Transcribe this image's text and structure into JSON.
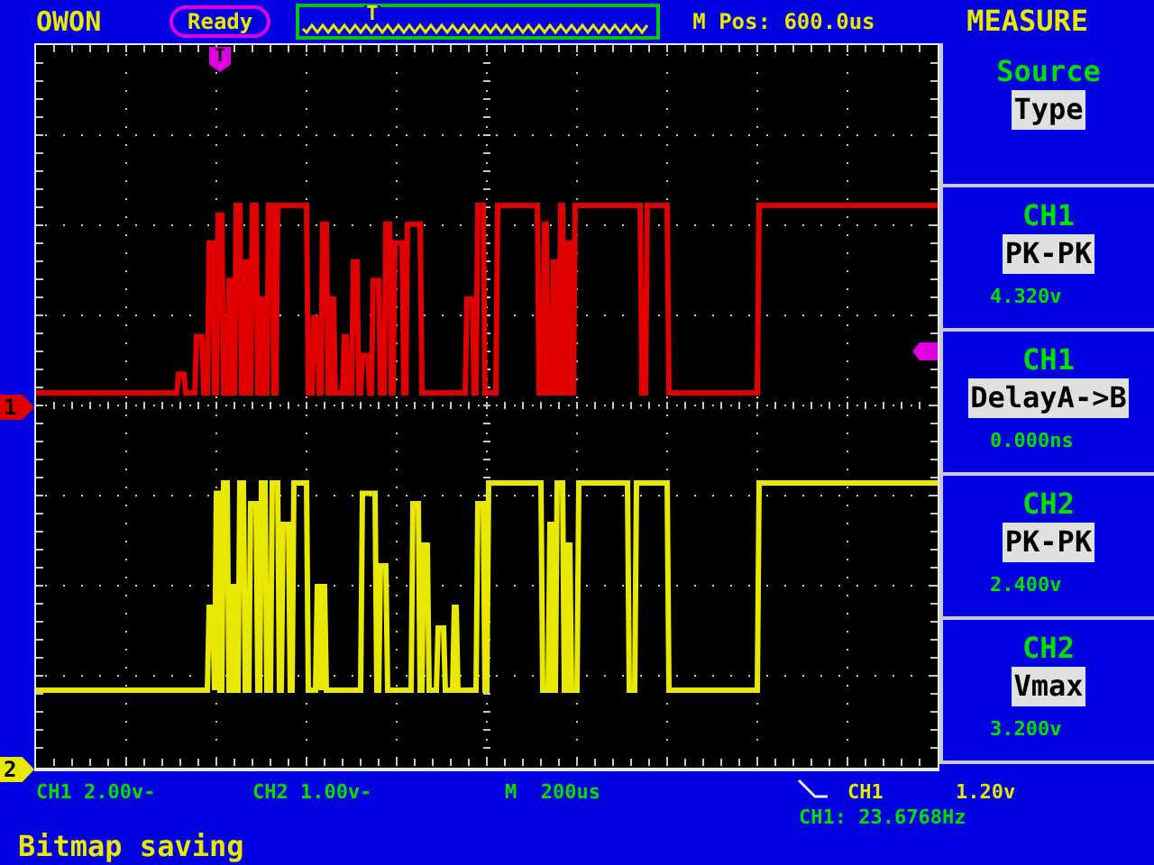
{
  "top_bar": {
    "brand": "OWON",
    "status": "Ready",
    "timebase_mark": "T",
    "m_pos": "M Pos: 600.0us",
    "menu_title": "MEASURE"
  },
  "plot": {
    "trigger_marker": "T",
    "channel_markers": [
      {
        "label": "1",
        "color": "#e00000"
      },
      {
        "label": "2",
        "color": "#e8e800"
      }
    ]
  },
  "menu_items": [
    {
      "heading": "Source",
      "value": "Type"
    },
    {
      "heading": "CH1",
      "value": "PK-PK",
      "reading": "4.320v"
    },
    {
      "heading": "CH1",
      "value": "DelayA->B",
      "reading": "0.000ns"
    },
    {
      "heading": "CH2",
      "value": "PK-PK",
      "reading": "2.400v"
    },
    {
      "heading": "CH2",
      "value": "Vmax",
      "reading": "3.200v"
    }
  ],
  "status_bar": {
    "ch1_scale": "CH1 2.00v-",
    "ch2_scale": "CH2 1.00v-",
    "timebase": "M  200us",
    "trigger_source": "CH1",
    "trigger_level": "1.20v",
    "frequency": "CH1: 23.6768Hz"
  },
  "message": "Bitmap saving"
}
